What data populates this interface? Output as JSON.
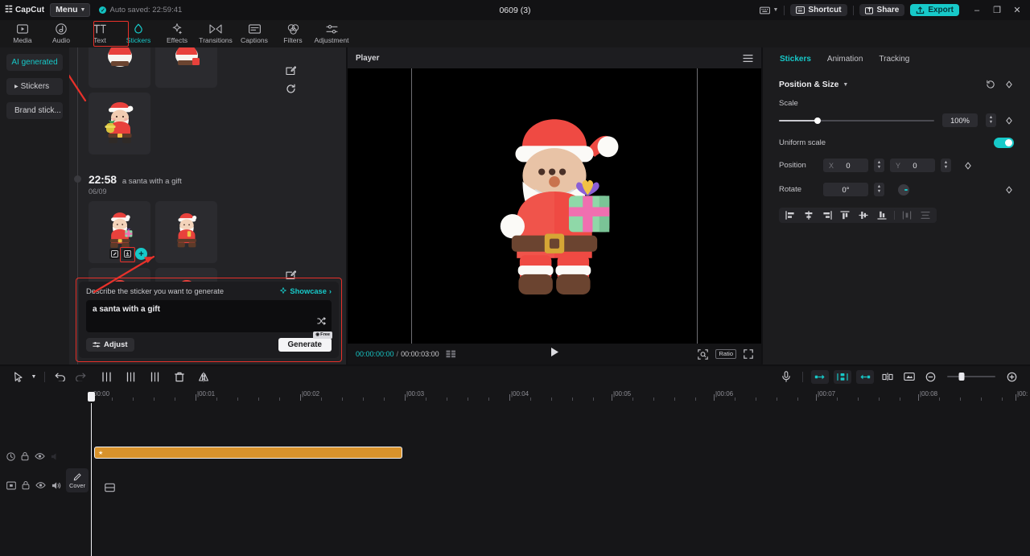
{
  "titlebar": {
    "app_name": "CapCut",
    "menu_label": "Menu",
    "autosave": "Auto saved: 22:59:41",
    "project_title": "0609 (3)",
    "shortcut_label": "Shortcut",
    "share_label": "Share",
    "export_label": "Export",
    "minimize": "–",
    "maximize": "❐",
    "close": "✕"
  },
  "nav": {
    "items": [
      {
        "label": "Media",
        "icon": "media-icon"
      },
      {
        "label": "Audio",
        "icon": "audio-icon"
      },
      {
        "label": "Text",
        "icon": "text-icon"
      },
      {
        "label": "Stickers",
        "icon": "stickers-icon"
      },
      {
        "label": "Effects",
        "icon": "effects-icon"
      },
      {
        "label": "Transitions",
        "icon": "transitions-icon"
      },
      {
        "label": "Captions",
        "icon": "captions-icon"
      },
      {
        "label": "Filters",
        "icon": "filters-icon"
      },
      {
        "label": "Adjustment",
        "icon": "adjustment-icon"
      }
    ],
    "active": "Stickers"
  },
  "left_sidebar": {
    "items": [
      {
        "label": "AI generated",
        "active": true
      },
      {
        "label": "Stickers",
        "active": false
      },
      {
        "label": "Brand stick...",
        "active": false
      }
    ]
  },
  "generation": {
    "batch_time": "22:58",
    "batch_prompt": "a santa with a gift",
    "batch_date": "06/09",
    "thumb_count": 4,
    "actions": {
      "edit": "edit-icon",
      "download": "download-icon",
      "add": "+"
    }
  },
  "prompt_panel": {
    "label": "Describe the sticker you want to generate",
    "showcase": "Showcase",
    "showcase_chevron": "›",
    "value": "a santa with a gift",
    "placeholder": "Describe the sticker you want to generate",
    "adjust_label": "Adjust",
    "generate_label": "Generate",
    "free_badge": "Free"
  },
  "player": {
    "title": "Player",
    "current_time": "00:00:00:00",
    "separator": "/",
    "total_time": "00:00:03:00",
    "ratio_label": "Ratio"
  },
  "right_panel": {
    "tabs": [
      {
        "label": "Stickers",
        "active": true
      },
      {
        "label": "Animation",
        "active": false
      },
      {
        "label": "Tracking",
        "active": false
      }
    ],
    "section_title": "Position & Size",
    "scale_label": "Scale",
    "scale_value": "100%",
    "scale_percent": 25,
    "uniform_label": "Uniform scale",
    "uniform_on": true,
    "position_label": "Position",
    "position_x_name": "X",
    "position_x": "0",
    "position_y_name": "Y",
    "position_y": "0",
    "rotate_label": "Rotate",
    "rotate_value": "0°"
  },
  "timeline": {
    "ruler_labels": [
      "00:00",
      "|00:01",
      "|00:02",
      "|00:03",
      "|00:04",
      "|00:05",
      "|00:06",
      "|00:07",
      "|00:08",
      "|00:"
    ],
    "playhead_time": "00:00",
    "sticker_clip_label": "★",
    "cover_label": "Cover",
    "zoom_percent": 30
  },
  "colors": {
    "accent": "#17c9c9",
    "highlight": "#e8312a",
    "clip": "#d8922b",
    "panel": "#1c1c1e"
  }
}
